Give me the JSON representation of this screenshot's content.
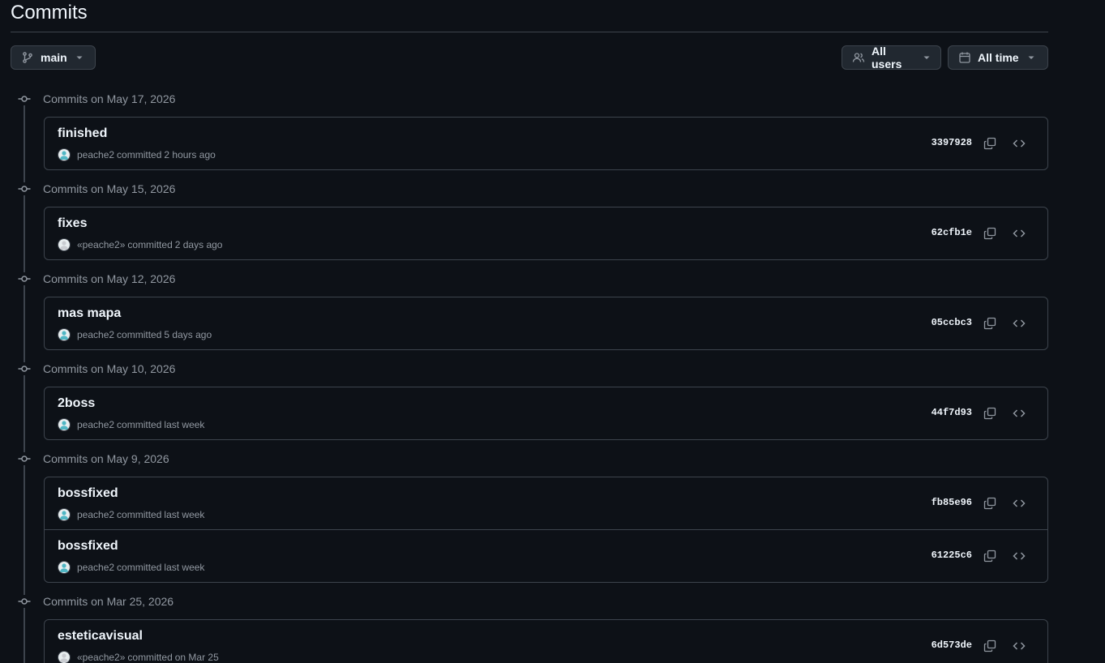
{
  "page": {
    "title": "Commits"
  },
  "toolbar": {
    "branch_label": "main",
    "users_label": "All users",
    "time_label": "All time"
  },
  "groups": [
    {
      "date": "Commits on May 17, 2026",
      "commits": [
        {
          "message": "finished",
          "author": "peache2",
          "action": "committed",
          "time": "2 hours ago",
          "sha": "3397928",
          "avatar": "teal"
        }
      ]
    },
    {
      "date": "Commits on May 15, 2026",
      "commits": [
        {
          "message": "fixes",
          "author": "«peache2»",
          "action": "committed",
          "time": "2 days ago",
          "sha": "62cfb1e",
          "avatar": "grey"
        }
      ]
    },
    {
      "date": "Commits on May 12, 2026",
      "commits": [
        {
          "message": "mas mapa",
          "author": "peache2",
          "action": "committed",
          "time": "5 days ago",
          "sha": "05ccbc3",
          "avatar": "teal"
        }
      ]
    },
    {
      "date": "Commits on May 10, 2026",
      "commits": [
        {
          "message": "2boss",
          "author": "peache2",
          "action": "committed",
          "time": "last week",
          "sha": "44f7d93",
          "avatar": "teal"
        }
      ]
    },
    {
      "date": "Commits on May 9, 2026",
      "commits": [
        {
          "message": "bossfixed",
          "author": "peache2",
          "action": "committed",
          "time": "last week",
          "sha": "fb85e96",
          "avatar": "teal"
        },
        {
          "message": "bossfixed",
          "author": "peache2",
          "action": "committed",
          "time": "last week",
          "sha": "61225c6",
          "avatar": "teal"
        }
      ]
    },
    {
      "date": "Commits on Mar 25, 2026",
      "commits": [
        {
          "message": "esteticavisual",
          "author": "«peache2»",
          "action": "committed",
          "time": "on Mar 25",
          "sha": "6d573de",
          "avatar": "grey"
        }
      ]
    }
  ],
  "colors": {
    "background": "#0d1117",
    "border": "#3d444d",
    "muted_text": "#9198a1",
    "primary_text": "#f0f6fc",
    "button_bg": "#212830",
    "avatar_teal": "#4fb6c4",
    "avatar_grey": "#c9ccd1"
  },
  "icons": {
    "branch": "git-branch-icon",
    "users": "people-icon",
    "time": "calendar-icon",
    "caret": "triangle-down-icon",
    "node": "git-commit-icon",
    "copy": "copy-icon",
    "code": "code-icon"
  }
}
